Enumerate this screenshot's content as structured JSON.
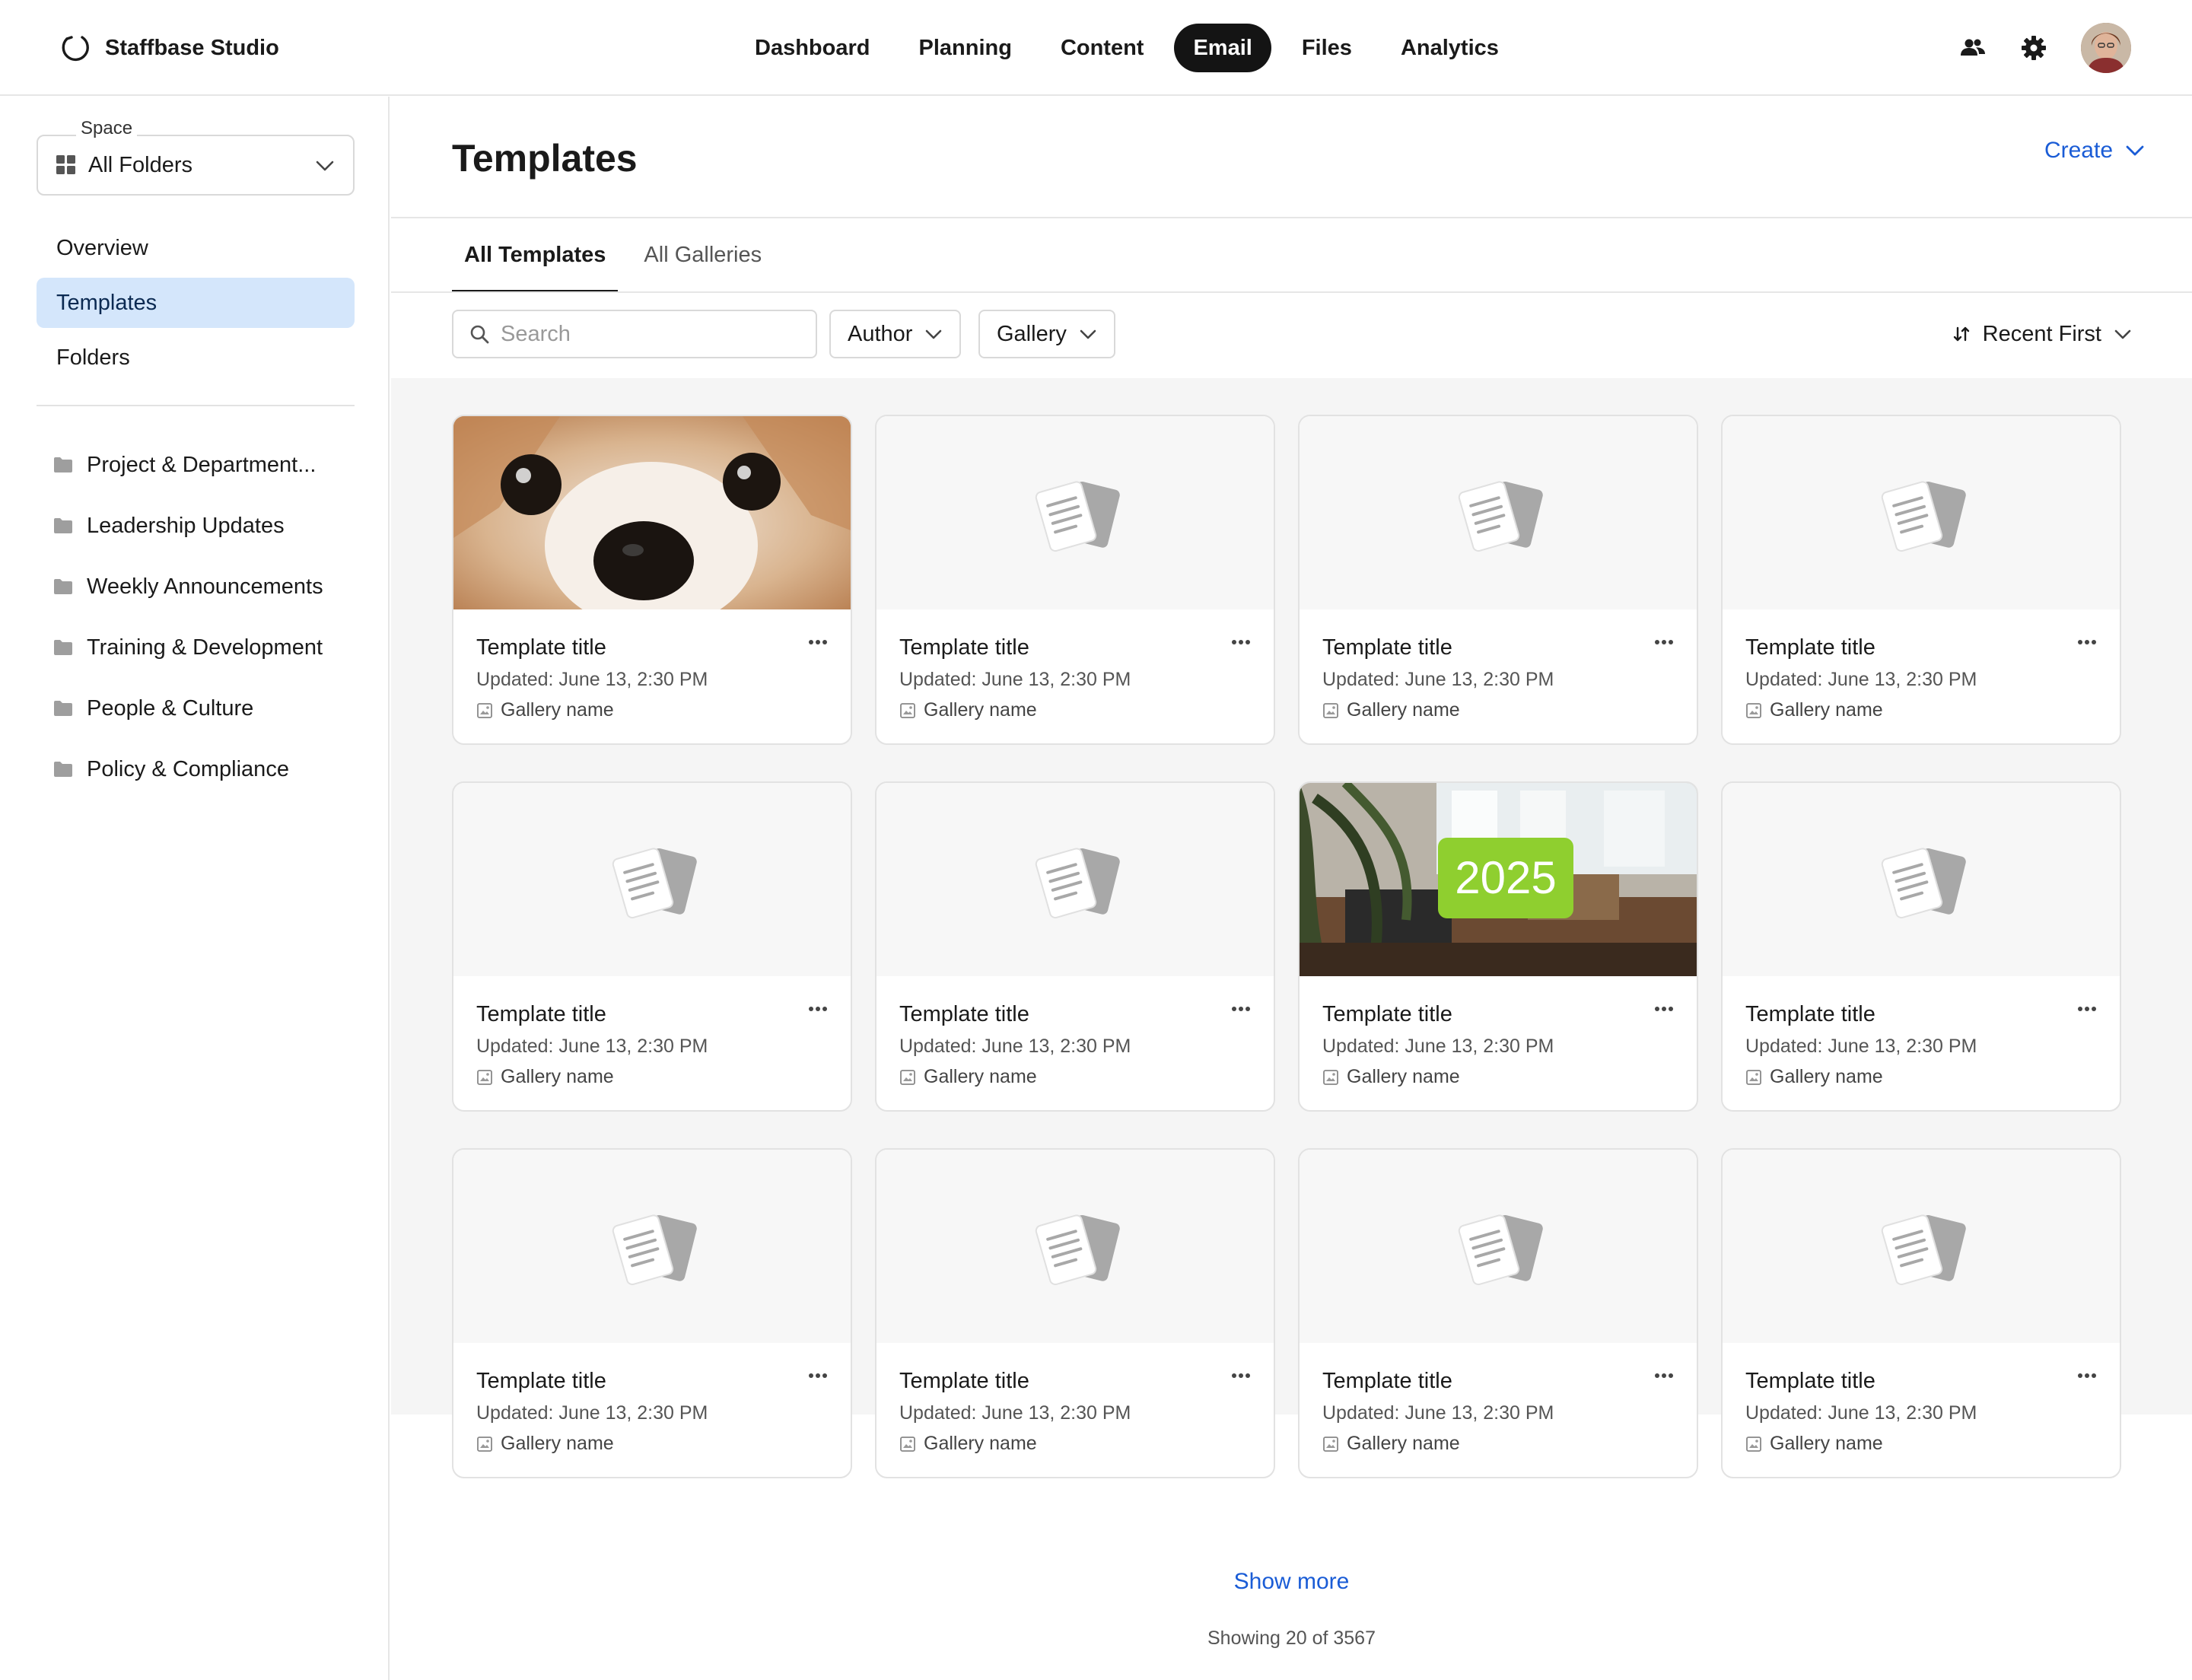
{
  "app": {
    "brand_name": "Staffbase Studio"
  },
  "nav": {
    "items": [
      {
        "label": "Dashboard"
      },
      {
        "label": "Planning"
      },
      {
        "label": "Content"
      },
      {
        "label": "Email"
      },
      {
        "label": "Files"
      },
      {
        "label": "Analytics"
      }
    ],
    "active": "Email"
  },
  "top_actions": {
    "icons": [
      "people-icon",
      "gear-icon",
      "avatar"
    ]
  },
  "sidebar": {
    "space_label": "Space",
    "space_value": "All Folders",
    "nav_items": [
      {
        "label": "Overview"
      },
      {
        "label": "Templates"
      },
      {
        "label": "Folders"
      }
    ],
    "active_nav": "Templates",
    "folders": [
      {
        "label": "Project & Department..."
      },
      {
        "label": "Leadership Updates"
      },
      {
        "label": "Weekly Announcements"
      },
      {
        "label": "Training & Development"
      },
      {
        "label": "People & Culture"
      },
      {
        "label": "Policy & Compliance"
      }
    ]
  },
  "main": {
    "title": "Templates",
    "create_label": "Create",
    "tabs": [
      {
        "label": "All Templates"
      },
      {
        "label": "All Galleries"
      }
    ],
    "active_tab": "All Templates",
    "search_placeholder": "Search",
    "filters": [
      {
        "label": "Author"
      },
      {
        "label": "Gallery"
      }
    ],
    "sort_label": "Recent First",
    "cards": [
      {
        "title": "Template title",
        "updated": "Updated: June 13, 2:30 PM",
        "gallery": "Gallery name",
        "thumb": "dog-photo"
      },
      {
        "title": "Template title",
        "updated": "Updated: June 13, 2:30 PM",
        "gallery": "Gallery name",
        "thumb": "placeholder"
      },
      {
        "title": "Template title",
        "updated": "Updated: June 13, 2:30 PM",
        "gallery": "Gallery name",
        "thumb": "placeholder"
      },
      {
        "title": "Template title",
        "updated": "Updated: June 13, 2:30 PM",
        "gallery": "Gallery name",
        "thumb": "placeholder"
      },
      {
        "title": "Template title",
        "updated": "Updated: June 13, 2:30 PM",
        "gallery": "Gallery name",
        "thumb": "placeholder"
      },
      {
        "title": "Template title",
        "updated": "Updated: June 13, 2:30 PM",
        "gallery": "Gallery name",
        "thumb": "placeholder"
      },
      {
        "title": "Template title",
        "updated": "Updated: June 13, 2:30 PM",
        "gallery": "Gallery name",
        "thumb": "office-photo",
        "thumb_badge": "2025",
        "badge_color": "#8fcf2f"
      },
      {
        "title": "Template title",
        "updated": "Updated: June 13, 2:30 PM",
        "gallery": "Gallery name",
        "thumb": "placeholder"
      },
      {
        "title": "Template title",
        "updated": "Updated: June 13, 2:30 PM",
        "gallery": "Gallery name",
        "thumb": "placeholder"
      },
      {
        "title": "Template title",
        "updated": "Updated: June 13, 2:30 PM",
        "gallery": "Gallery name",
        "thumb": "placeholder"
      },
      {
        "title": "Template title",
        "updated": "Updated: June 13, 2:30 PM",
        "gallery": "Gallery name",
        "thumb": "placeholder"
      },
      {
        "title": "Template title",
        "updated": "Updated: June 13, 2:30 PM",
        "gallery": "Gallery name",
        "thumb": "placeholder"
      }
    ],
    "show_more_label": "Show more",
    "showing_text": "Showing 20 of 3567"
  },
  "colors": {
    "accent_link": "#1a5cd6",
    "active_nav_bg": "#141414",
    "active_sidebar_bg": "#d4e6fb",
    "grid_bg": "#f5f5f5"
  }
}
